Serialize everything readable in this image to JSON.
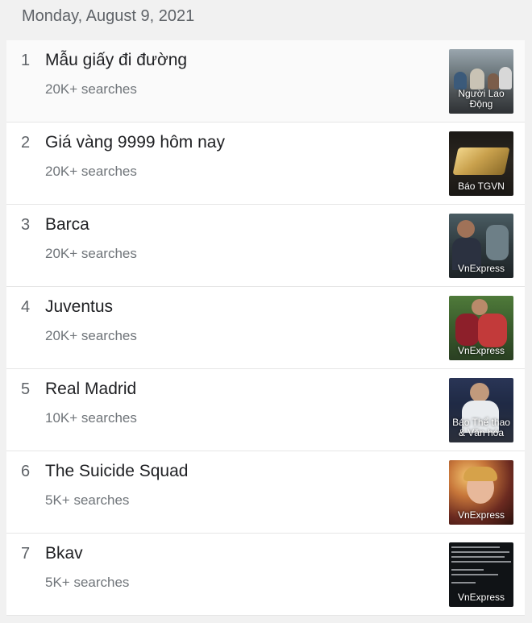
{
  "date": "Monday, August 9, 2021",
  "items": [
    {
      "rank": "1",
      "title": "Mẫu giấy đi đường",
      "count": "20K+ searches",
      "source": "Người Lao Động",
      "icon": "crowd-street-photo"
    },
    {
      "rank": "2",
      "title": "Giá vàng 9999 hôm nay",
      "count": "20K+ searches",
      "source": "Báo TGVN",
      "icon": "gold-bar-photo"
    },
    {
      "rank": "3",
      "title": "Barca",
      "count": "20K+ searches",
      "source": "VnExpress",
      "icon": "football-player-photo"
    },
    {
      "rank": "4",
      "title": "Juventus",
      "count": "20K+ searches",
      "source": "VnExpress",
      "icon": "football-celebration-photo"
    },
    {
      "rank": "5",
      "title": "Real Madrid",
      "count": "10K+ searches",
      "source": "Báo Thể thao & Văn hóa",
      "icon": "football-player-photo"
    },
    {
      "rank": "6",
      "title": "The Suicide Squad",
      "count": "5K+ searches",
      "source": "VnExpress",
      "icon": "movie-still-photo"
    },
    {
      "rank": "7",
      "title": "Bkav",
      "count": "5K+ searches",
      "source": "VnExpress",
      "icon": "code-screenshot-photo"
    }
  ]
}
